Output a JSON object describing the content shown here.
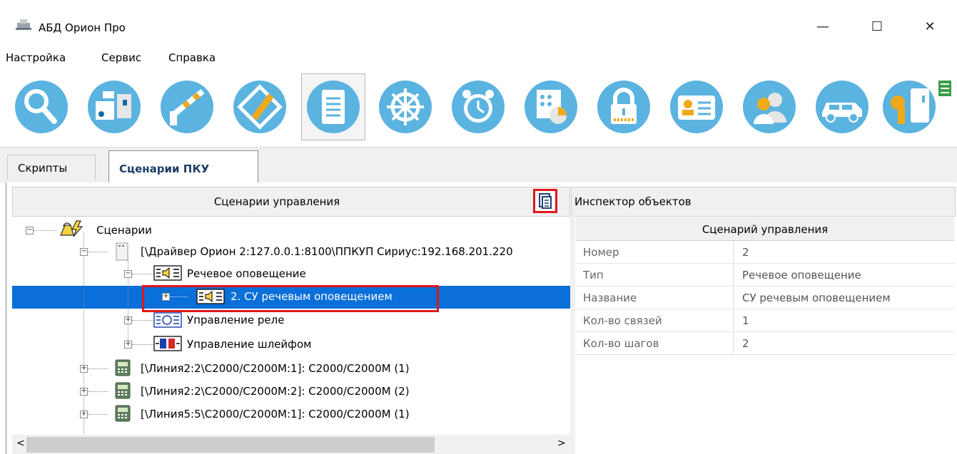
{
  "window": {
    "title": "АБД Орион Про",
    "controls": {
      "minimize": "—",
      "maximize": "☐",
      "close": "✕"
    }
  },
  "menu": [
    "Настройка",
    "Сервис",
    "Справка"
  ],
  "toolbar": {
    "buttons": [
      "search-icon",
      "devices-icon",
      "barrier-icon",
      "plan-editor-icon",
      "list-icon",
      "wheel-icon",
      "alarm-clock-icon",
      "panel-icon",
      "lock-icon",
      "id-card-icon",
      "users-icon",
      "car-icon",
      "key-icon"
    ],
    "active_index": 4,
    "accent": "#5bb3e0"
  },
  "tabs": {
    "scripts": "Скрипты",
    "scenarios": "Сценарии ПКУ"
  },
  "left_panel": {
    "header": "Сценарии управления",
    "tree": {
      "root": "Сценарии",
      "driver": "[\\Драйвер Орион 2:127.0.0.1:8100\\ППКУП Сириус:192.168.201.220",
      "speech": "Речевое оповещение",
      "selected_item": "2. СУ речевым оповещением",
      "relay": "Управление реле",
      "loop": "Управление шлейфом",
      "lines": [
        "[\\Линия2:2\\С2000/С2000М:1]: С2000/С2000М (1)",
        "[\\Линия2:2\\С2000/С2000М:2]: С2000/С2000М (2)",
        "[\\Линия5:5\\С2000/С2000М:1]: С2000/С2000М (1)"
      ]
    }
  },
  "inspector": {
    "header": "Инспектор объектов",
    "title": "Сценарий управления",
    "rows": [
      {
        "name": "Номер",
        "value": "2"
      },
      {
        "name": "Тип",
        "value": "Речевое оповещение"
      },
      {
        "name": "Название",
        "value": "СУ речевым оповещением"
      },
      {
        "name": "Кол-во связей",
        "value": "1"
      },
      {
        "name": "Кол-во шагов",
        "value": "2"
      }
    ]
  },
  "scroll": {
    "left": "<",
    "right": ">"
  },
  "colors": {
    "selection": "#0a6fd8",
    "highlight": "#e0161b"
  }
}
